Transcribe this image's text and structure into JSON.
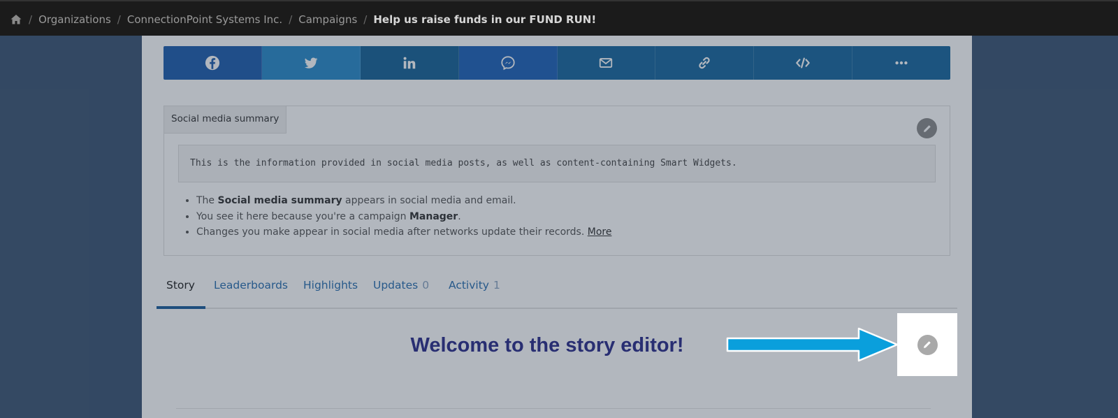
{
  "breadcrumb": {
    "items": [
      "Organizations",
      "ConnectionPoint Systems Inc.",
      "Campaigns"
    ],
    "current": "Help us raise funds in our FUND RUN!",
    "separator": "/"
  },
  "share_buttons": [
    {
      "icon": "facebook-icon",
      "color": "#1f5fae"
    },
    {
      "icon": "twitter-icon",
      "color": "#2a8bc9"
    },
    {
      "icon": "linkedin-icon",
      "color": "#176397"
    },
    {
      "icon": "messenger-icon",
      "color": "#1f63b8"
    },
    {
      "icon": "email-icon",
      "color": "#19689f"
    },
    {
      "icon": "link-icon",
      "color": "#19689f"
    },
    {
      "icon": "embed-code-icon",
      "color": "#19689f"
    },
    {
      "icon": "more-icon",
      "color": "#19689f"
    }
  ],
  "summary": {
    "tab_label": "Social media summary",
    "note": "This is the information provided in social media posts, as well as content-containing Smart Widgets.",
    "bullets": {
      "b1_pre": "The ",
      "b1_bold": "Social media summary",
      "b1_post": " appears in social media and email.",
      "b2_pre": "You see it here because you're a campaign ",
      "b2_bold": "Manager",
      "b2_post": ".",
      "b3_pre": "Changes you make appear in social media after networks update their records. ",
      "b3_link": "More"
    }
  },
  "tabs": [
    {
      "label": "Story",
      "count": ""
    },
    {
      "label": "Leaderboards",
      "count": ""
    },
    {
      "label": "Highlights",
      "count": ""
    },
    {
      "label": "Updates",
      "count": "0"
    },
    {
      "label": "Activity",
      "count": "1"
    }
  ],
  "story": {
    "title": "Welcome to the story editor!"
  },
  "colors": {
    "topbar": "#1b1b1b",
    "page_background": "#3d5573",
    "arrow": "#0a9fdc",
    "story_title": "#2c2d8a"
  }
}
